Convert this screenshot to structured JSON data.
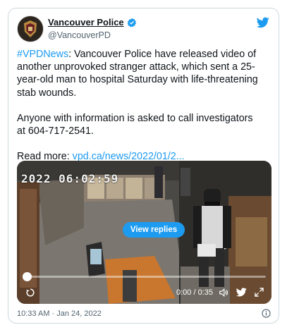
{
  "tweet": {
    "author_name": "Vancouver Police",
    "author_handle": "@VancouverPD",
    "hashtag": "#VPDNews",
    "text_1": ": Vancouver Police have released video of another unprovoked stranger attack, which sent a 25-year-old man to hospital Saturday with life-threatening stab wounds.",
    "text_2": "Anyone with information is asked to call investigators at 604-717-2541.",
    "read_more_prefix": "Read more: ",
    "read_more_link": "vpd.ca/news/2022/01/2...",
    "date": "10:33 AM · Jan 24, 2022"
  },
  "media": {
    "timestamp": "2022 06:02:59",
    "view_replies": "View replies",
    "time_display": "0:00 / 0:35",
    "progress": 0
  },
  "icons": {
    "verified": "verified-badge-icon",
    "twitter": "twitter-bird-icon",
    "replay": "replay-icon",
    "volume": "volume-icon",
    "fullscreen": "fullscreen-icon",
    "info": "info-icon"
  },
  "colors": {
    "link": "#1d9bf0",
    "text": "#0f1419",
    "muted": "#536471"
  }
}
